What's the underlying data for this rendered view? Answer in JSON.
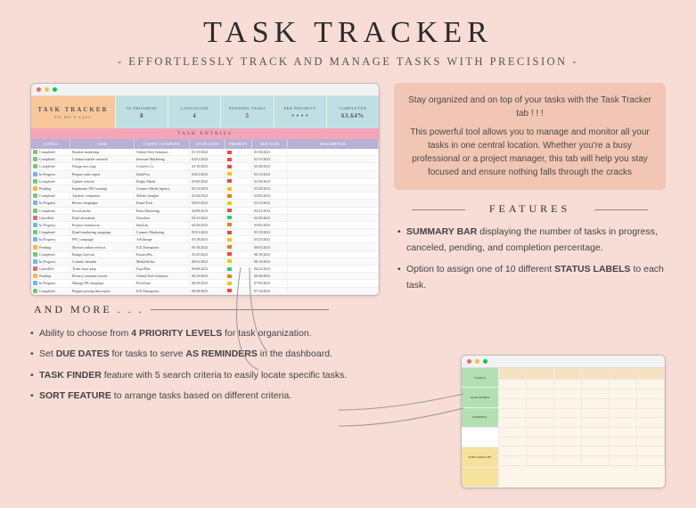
{
  "title": "TASK TRACKER",
  "subtitle": "- EFFORTLESSLY TRACK AND MANAGE TASKS WITH PRECISION -",
  "sheet": {
    "title": "TASK TRACKER",
    "sub": "TO DO'S LIST",
    "stats": [
      {
        "label": "IN PROGRESS",
        "value": "8"
      },
      {
        "label": "CANCELLED",
        "value": "4"
      },
      {
        "label": "PENDING TASKS",
        "value": "5"
      },
      {
        "label": "PER PRIORITY",
        "value": "• • • •"
      },
      {
        "label": "COMPLETED",
        "value": "63.64%"
      }
    ],
    "entries_title": "TASK ENTRIES",
    "headers": [
      "STATUS",
      "TASK",
      "CLIENT / COMPANY",
      "START DATE",
      "PRIORITY",
      "DUE DATE",
      "DESCRIPTION"
    ],
    "rows": [
      {
        "s": "Completed",
        "sc": "#7cc47c",
        "t": "Finalize marketing",
        "c": "Global Tech Solutions",
        "sd": "01/15/2023",
        "p": "r",
        "dd": "01/30/2023"
      },
      {
        "s": "Completed",
        "sc": "#7cc47c",
        "t": "Conduct market research",
        "c": "Innovate Marketing",
        "sd": "02/01/2023",
        "p": "r",
        "dd": "02/15/2023"
      },
      {
        "s": "Completed",
        "sc": "#7cc47c",
        "t": "Design new logo",
        "c": "Creative Co.",
        "sd": "02/10/2023",
        "p": "r",
        "dd": "02/28/2023"
      },
      {
        "s": "In Progress",
        "sc": "#6fb6e6",
        "t": "Prepare sales report",
        "c": "DataFirst",
        "sd": "03/01/2023",
        "p": "y",
        "dd": "03/15/2023"
      },
      {
        "s": "Completed",
        "sc": "#7cc47c",
        "t": "Update website",
        "c": "Bright Media",
        "sd": "03/05/2023",
        "p": "r",
        "dd": "03/20/2023"
      },
      {
        "s": "Pending",
        "sc": "#f0b84e",
        "t": "Implement SEO strategy",
        "c": "Connect Media Agency",
        "sd": "03/12/2023",
        "p": "y",
        "dd": "03/30/2023"
      },
      {
        "s": "Completed",
        "sc": "#7cc47c",
        "t": "Analyze competitor",
        "c": "Market Insights",
        "sd": "03/20/2023",
        "p": "o",
        "dd": "04/05/2023"
      },
      {
        "s": "In Progress",
        "sc": "#6fb6e6",
        "t": "Revise campaigns",
        "c": "Email Tech",
        "sd": "04/01/2023",
        "p": "y",
        "dd": "04/15/2023"
      },
      {
        "s": "Completed",
        "sc": "#7cc47c",
        "t": "Social media",
        "c": "Buzz Marketing",
        "sd": "04/08/2023",
        "p": "r",
        "dd": "04/22/2023"
      },
      {
        "s": "Cancelled",
        "sc": "#d67070",
        "t": "Draft newsletter",
        "c": "Newsline",
        "sd": "04/15/2023",
        "p": "g",
        "dd": "04/30/2023"
      },
      {
        "s": "In Progress",
        "sc": "#6fb6e6",
        "t": "Product brainstorm",
        "c": "IdeaLab",
        "sd": "04/20/2023",
        "p": "o",
        "dd": "05/05/2023"
      },
      {
        "s": "Completed",
        "sc": "#7cc47c",
        "t": "Email marketing campaign",
        "c": "Connect Marketing",
        "sd": "05/01/2023",
        "p": "r",
        "dd": "05/15/2023"
      },
      {
        "s": "In Progress",
        "sc": "#6fb6e6",
        "t": "PPC campaign",
        "c": "AdVantage",
        "sd": "05/10/2023",
        "p": "y",
        "dd": "05/25/2023"
      },
      {
        "s": "Pending",
        "sc": "#f0b84e",
        "t": "Monitor online reviews",
        "c": "ICE Enterprises",
        "sd": "05/18/2023",
        "p": "o",
        "dd": "06/01/2023"
      },
      {
        "s": "Completed",
        "sc": "#7cc47c",
        "t": "Budget forecast",
        "c": "FinancePro",
        "sd": "05/25/2023",
        "p": "r",
        "dd": "06/10/2023"
      },
      {
        "s": "In Progress",
        "sc": "#6fb6e6",
        "t": "Content calendar",
        "c": "MediaWorks",
        "sd": "06/01/2023",
        "p": "y",
        "dd": "06/15/2023"
      },
      {
        "s": "Cancelled",
        "sc": "#d67070",
        "t": "Trade show prep",
        "c": "ExpoPlus",
        "sd": "06/08/2023",
        "p": "g",
        "dd": "06/22/2023"
      },
      {
        "s": "Pending",
        "sc": "#f0b84e",
        "t": "Review customer survey",
        "c": "Global Tech Solutions",
        "sd": "06/15/2023",
        "p": "o",
        "dd": "06/30/2023"
      },
      {
        "s": "In Progress",
        "sc": "#6fb6e6",
        "t": "Manage PR campaign",
        "c": "PressLine",
        "sd": "06/20/2023",
        "p": "y",
        "dd": "07/05/2023"
      },
      {
        "s": "Completed",
        "sc": "#7cc47c",
        "t": "Prepare pricing data report",
        "c": "ICE Enterprises",
        "sd": "06/28/2023",
        "p": "r",
        "dd": "07/12/2023"
      }
    ]
  },
  "intro": {
    "lead": "Stay organized and on top of your tasks with the Task Tracker tab ! ! !",
    "body": "This powerful tool allows you to manage and monitor all your tasks in one central location. Whether you're a busy professional or a project manager, this tab will help you stay focused and ensure nothing falls through the cracks"
  },
  "features_heading": "FEATURES",
  "features": [
    "SUMMARY BAR displaying the number of tasks in progress, canceled, pending, and completion percentage.",
    "Option to assign one of 10 different STATUS LABELS to each task."
  ],
  "more_heading": "AND MORE . . .",
  "more": [
    "Ability to choose from 4 PRIORITY LEVELS for task organization.",
    "Set DUE DATES for tasks to serve AS REMINDERS in the dashboard.",
    "TASK FINDER feature with 5 search criteria to easily locate specific tasks.",
    "SORT FEATURE to arrange tasks based on different criteria."
  ],
  "mini_labels": [
    "STATUS",
    "TASK FINDER",
    "PRIORITY",
    "",
    "SORT TASKS BY",
    ""
  ]
}
